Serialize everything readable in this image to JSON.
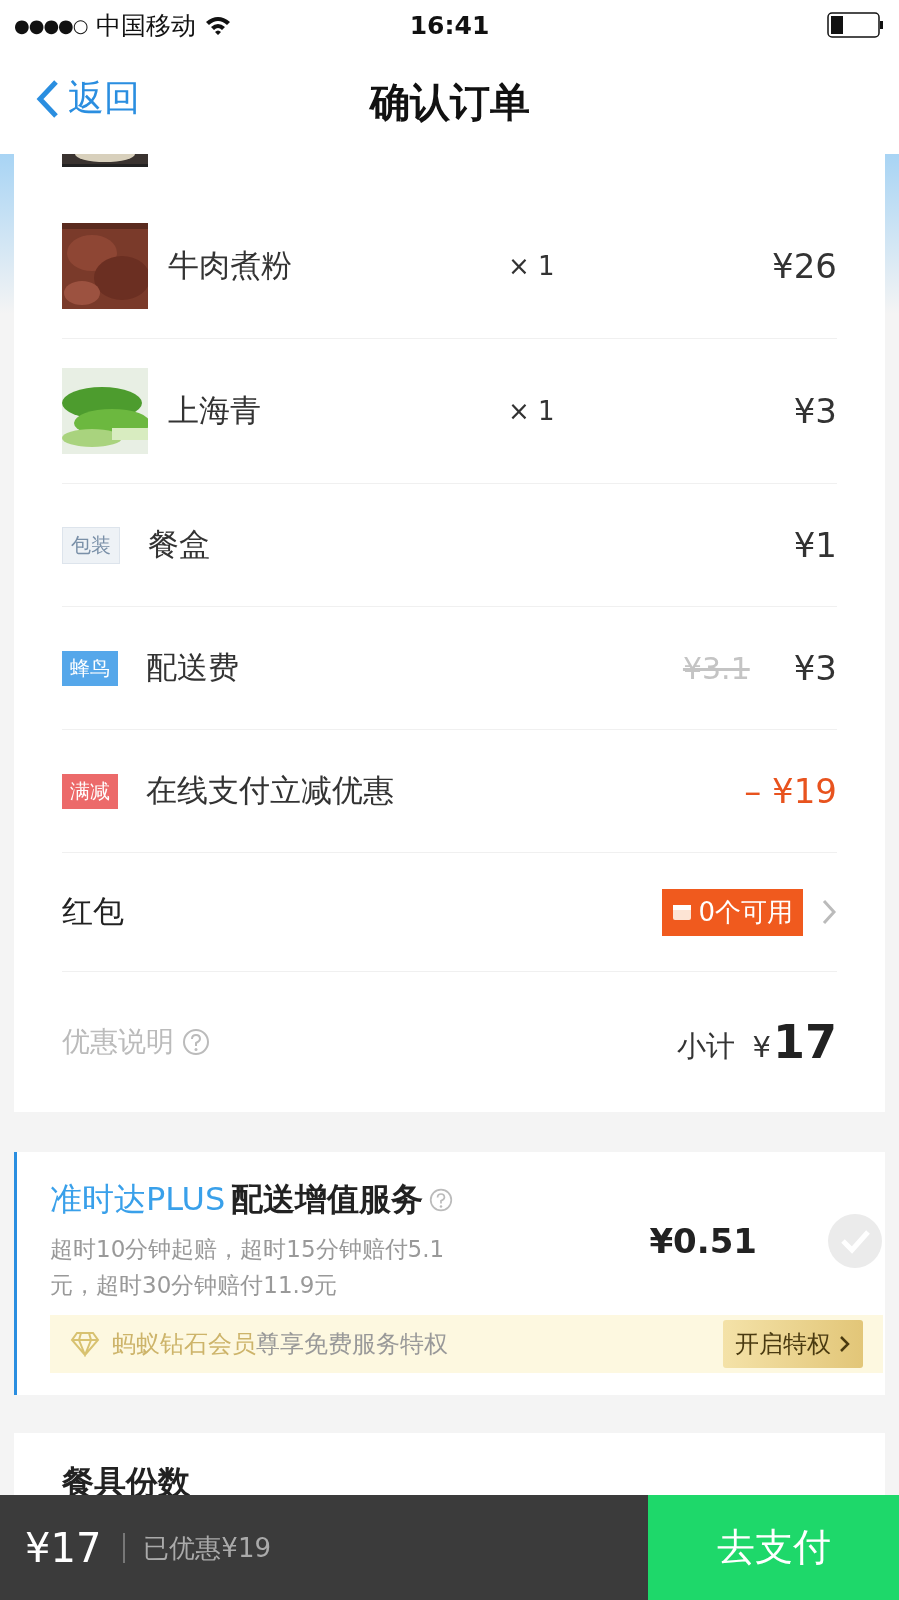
{
  "status_bar": {
    "signal": "●●●●○",
    "carrier": "中国移动",
    "time": "16:41"
  },
  "nav": {
    "back": "返回",
    "title": "确认订单"
  },
  "dishes": [
    {
      "name": "牛肉煮粉",
      "quantity": "× 1",
      "price": "¥26"
    },
    {
      "name": "上海青",
      "quantity": "× 1",
      "price": "¥3"
    }
  ],
  "fees": [
    {
      "kind": "packaging",
      "tag": "包装",
      "name": "餐盒",
      "price": "¥1"
    },
    {
      "kind": "delivery",
      "tag": "蜂鸟",
      "name": "配送费",
      "original_price": "¥3.1",
      "price": "¥3"
    },
    {
      "kind": "discount",
      "tag": "满减",
      "name": "在线支付立减优惠",
      "price": "– ¥19"
    }
  ],
  "red_packet": {
    "label": "红包",
    "badge": "0个可用"
  },
  "summary": {
    "note": "优惠说明",
    "subtotal_label": "小计",
    "subtotal_currency": "¥",
    "subtotal": "17"
  },
  "service": {
    "brand": "准时达PLUS",
    "title": "配送增值服务",
    "description": "超时10分钟起赔，超时15分钟赔付5.1元，超时30分钟赔付11.9元",
    "price": "¥0.51",
    "checked": false,
    "promo": {
      "highlight": "蚂蚁钻石会员",
      "text": "尊享免费服务特权",
      "button": "开启特权"
    }
  },
  "next_section": {
    "label": "餐具份数"
  },
  "bottom_bar": {
    "total": "¥17",
    "saved": "已优惠¥19",
    "pay": "去支付"
  }
}
